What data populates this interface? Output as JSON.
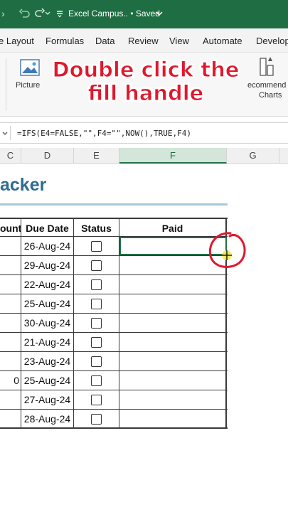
{
  "titlebar": {
    "back_icon": "back-arrow-icon",
    "redo_icon": "redo-icon",
    "more_icon": "overflow-icon",
    "title": "Excel Campus.. • Saved",
    "chevron": "⌄"
  },
  "tabs": [
    "e Layout",
    "Formulas",
    "Data",
    "Review",
    "View",
    "Automate",
    "Develop"
  ],
  "ribbon": {
    "pictures_label": "Picture",
    "recommended_line1": "ecommend",
    "recommended_line2": "Charts"
  },
  "overlay": {
    "line1": "Double click the",
    "line2": "fill handle",
    "color": "#e0182d"
  },
  "formula_bar": {
    "formula": "=IFS(E4=FALSE,\"\",F4=\"\",NOW(),TRUE,F4)"
  },
  "columns": [
    "C",
    "D",
    "E",
    "F",
    "G"
  ],
  "selected_column": "F",
  "sheet_title": "acker",
  "table": {
    "headers": [
      "ount",
      "Due Date",
      "Status",
      "Paid"
    ],
    "rows": [
      {
        "amount": "",
        "due": "26-Aug-24",
        "status": false,
        "paid": ""
      },
      {
        "amount": "",
        "due": "29-Aug-24",
        "status": false,
        "paid": ""
      },
      {
        "amount": "",
        "due": "22-Aug-24",
        "status": false,
        "paid": ""
      },
      {
        "amount": "",
        "due": "25-Aug-24",
        "status": false,
        "paid": ""
      },
      {
        "amount": "",
        "due": "30-Aug-24",
        "status": false,
        "paid": ""
      },
      {
        "amount": "",
        "due": "21-Aug-24",
        "status": false,
        "paid": ""
      },
      {
        "amount": "",
        "due": "23-Aug-24",
        "status": false,
        "paid": ""
      },
      {
        "amount": "0",
        "due": "25-Aug-24",
        "status": false,
        "paid": ""
      },
      {
        "amount": "",
        "due": "27-Aug-24",
        "status": false,
        "paid": ""
      },
      {
        "amount": "",
        "due": "28-Aug-24",
        "status": false,
        "paid": ""
      }
    ]
  },
  "accent_color": "#1e7145"
}
